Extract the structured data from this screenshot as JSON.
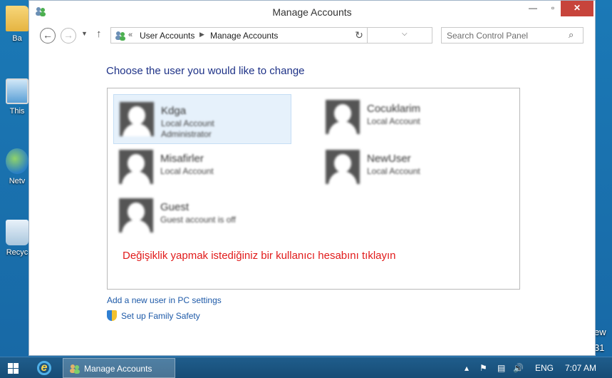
{
  "desktop": {
    "icons": [
      {
        "label": "Ba",
        "icon": "folder-icon"
      },
      {
        "label": "This",
        "icon": "computer-icon"
      },
      {
        "label": "Netv",
        "icon": "network-icon"
      },
      {
        "label": "Recyc",
        "icon": "recycle-bin-icon"
      }
    ],
    "right_text_1": "ew",
    "right_text_2": "31"
  },
  "window": {
    "title": "Manage Accounts",
    "minimize": "—",
    "maximize": "▫",
    "close": "✕"
  },
  "navigation": {
    "back": "←",
    "forward": "→",
    "dropdown": "▼",
    "up": "↑",
    "address_prefix": "«",
    "breadcrumbs": [
      "User Accounts",
      "Manage Accounts"
    ],
    "breadcrumb_separator": "▶",
    "address_chevron": "⌵",
    "refresh": "↻",
    "search_placeholder": "Search Control Panel",
    "search_icon": "⌕"
  },
  "content": {
    "heading": "Choose the user you would like to change",
    "users": [
      {
        "name": "Kdga",
        "type": "Local Account",
        "role": "Administrator",
        "selected": true
      },
      {
        "name": "Cocuklarim",
        "type": "Local Account",
        "role": "",
        "selected": false
      },
      {
        "name": "Misafirler",
        "type": "Local Account",
        "role": "",
        "selected": false
      },
      {
        "name": "NewUser",
        "type": "Local Account",
        "role": "",
        "selected": false
      },
      {
        "name": "Guest",
        "type": "Guest account is off",
        "role": "",
        "selected": false
      }
    ],
    "hint": "Değişiklik yapmak istediğiniz bir kullanıcı hesabını tıklayın",
    "links": {
      "add_user": "Add a new user in PC settings",
      "family_safety": "Set up Family Safety"
    }
  },
  "taskbar": {
    "active_window": "Manage Accounts",
    "language": "ENG",
    "time": "7:07 AM",
    "tray_arrow": "▴",
    "flag": "⚑",
    "network": "▤",
    "volume": "🔊"
  },
  "colors": {
    "heading": "#1e3287",
    "link": "#1e5aa8",
    "hint": "#e11b1b",
    "close_button": "#c7443b",
    "desktop": "#1b79b6"
  }
}
